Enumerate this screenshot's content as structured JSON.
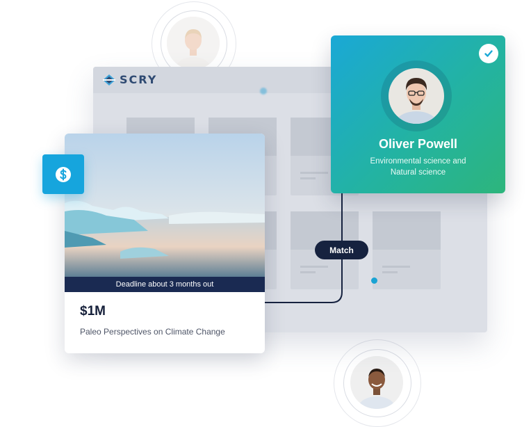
{
  "logo": {
    "text": "SCRY"
  },
  "grant": {
    "deadline": "Deadline about 3 months out",
    "amount": "$1M",
    "title": "Paleo Perspectives on Climate Change"
  },
  "profile": {
    "name": "Oliver Powell",
    "field_line1": "Environmental science and",
    "field_line2": "Natural science"
  },
  "match": {
    "label": "Match"
  },
  "colors": {
    "accent": "#16a5dd",
    "navy": "#16223f",
    "gradient_start": "#1aa8d6",
    "gradient_end": "#2db57c"
  },
  "icons": [
    "scry-logo-icon",
    "dollar-icon",
    "check-icon"
  ]
}
